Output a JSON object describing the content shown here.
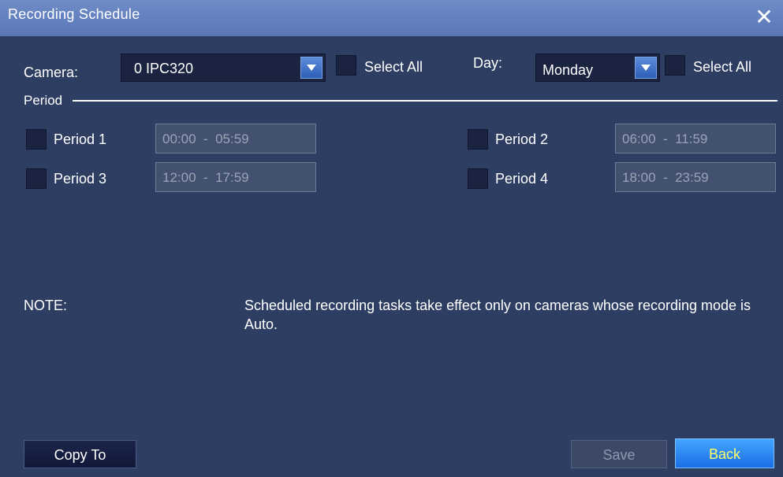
{
  "window": {
    "title": "Recording Schedule",
    "close_icon": "close-icon"
  },
  "camera": {
    "label": "Camera:",
    "selected": "0 IPC320",
    "select_all_label": "Select All"
  },
  "day": {
    "label": "Day:",
    "selected": "Monday",
    "select_all_label": "Select All"
  },
  "period_section": {
    "label": "Period"
  },
  "periods": [
    {
      "label": "Period 1",
      "range": "00:00  -  05:59"
    },
    {
      "label": "Period 2",
      "range": "06:00  -  11:59"
    },
    {
      "label": "Period 3",
      "range": "12:00  -  17:59"
    },
    {
      "label": "Period 4",
      "range": "18:00  -  23:59"
    }
  ],
  "note": {
    "label": "NOTE:",
    "text": "Scheduled recording tasks take effect only on cameras whose recording mode is Auto."
  },
  "buttons": {
    "copy_to": "Copy To",
    "save": "Save",
    "back": "Back"
  },
  "colors": {
    "titlebar": "#5a77b7",
    "background": "#2d3e62",
    "back_button": "#1a6de6",
    "back_text": "#ffff66"
  }
}
